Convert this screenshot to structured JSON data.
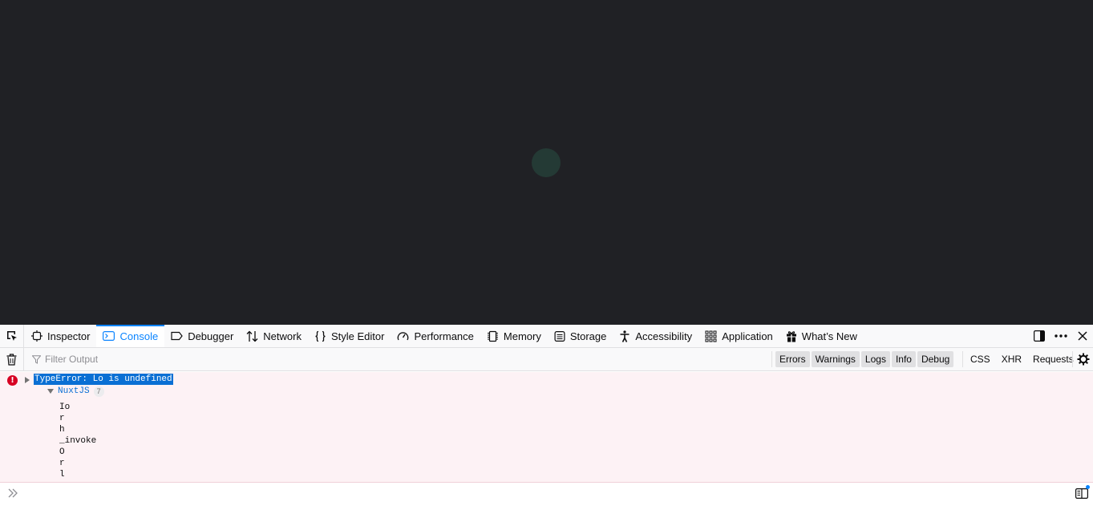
{
  "toolbox": {
    "tabs": [
      {
        "id": "inspector",
        "label": "Inspector",
        "icon": "inspector-icon"
      },
      {
        "id": "console",
        "label": "Console",
        "icon": "console-icon",
        "selected": true
      },
      {
        "id": "debugger",
        "label": "Debugger",
        "icon": "debugger-icon"
      },
      {
        "id": "network",
        "label": "Network",
        "icon": "network-icon"
      },
      {
        "id": "styleeditor",
        "label": "Style Editor",
        "icon": "style-editor-icon"
      },
      {
        "id": "performance",
        "label": "Performance",
        "icon": "performance-icon"
      },
      {
        "id": "memory",
        "label": "Memory",
        "icon": "memory-icon"
      },
      {
        "id": "storage",
        "label": "Storage",
        "icon": "storage-icon"
      },
      {
        "id": "accessibility",
        "label": "Accessibility",
        "icon": "accessibility-icon"
      },
      {
        "id": "application",
        "label": "Application",
        "icon": "application-icon"
      },
      {
        "id": "whatsnew",
        "label": "What’s New",
        "icon": "gift-icon"
      }
    ]
  },
  "filter": {
    "placeholder": "Filter Output",
    "levels": [
      "Errors",
      "Warnings",
      "Logs",
      "Info",
      "Debug"
    ],
    "extras": [
      "CSS",
      "XHR",
      "Requests"
    ]
  },
  "console": {
    "error_message": "TypeError: Lo is undefined",
    "group_name": "NuxtJS",
    "group_count": "7",
    "frames": [
      "Io",
      "r",
      "h",
      "_invoke",
      "O",
      "r",
      "l"
    ]
  },
  "colors": {
    "accent": "#0a84ff",
    "error": "#d70022",
    "error_bg": "#fdf2f5",
    "page_bg": "#202125"
  }
}
